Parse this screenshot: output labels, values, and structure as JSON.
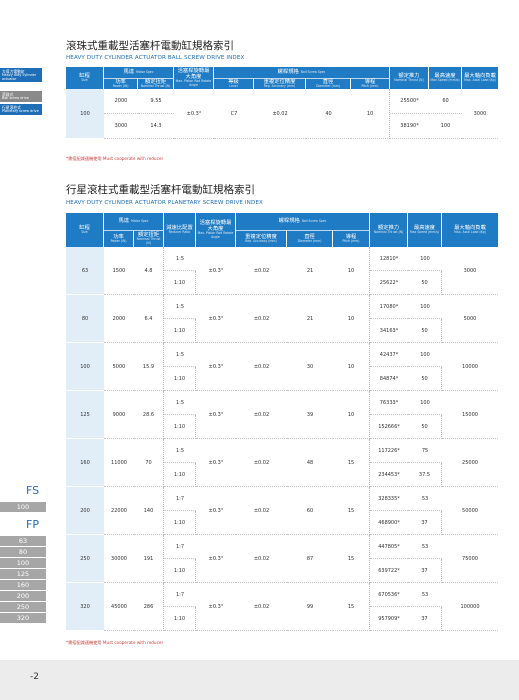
{
  "sidebar": {
    "items": [
      {
        "line1": "大導力電動缸",
        "line2": "Heavy duty cylinder",
        "line3": "actuator"
      },
      {
        "line1": "滾珠式",
        "line2": "Ball screw drive"
      },
      {
        "line1": "行星滾柱式",
        "line2": "Planetary screw drive"
      }
    ],
    "colors": {
      "item0": "#1f6fb8",
      "item1": "#888888",
      "item2": "#1f6fb8"
    }
  },
  "section1": {
    "title_zh": "滾珠式重載型活塞杆電動缸規格索引",
    "title_en": "HEAVY DUTY CYLINDER ACTUATOR BALL SCREW DRIVE INDEX",
    "headers": {
      "size_zh": "缸程",
      "size_en": "Size",
      "motor_zh": "馬達",
      "motor_en": "Motor Spec",
      "power_zh": "功率",
      "power_en": "Power (W)",
      "thrust_zh": "額定扭矩",
      "thrust_en": "Nominal Thrust (N)",
      "angle_zh": "活塞桿旋轉最大角度",
      "angle_en": "Max. Piston Rod Rotate Angle",
      "screw_zh": "螺桿規格",
      "screw_en": "Ball Screw Spec",
      "level_zh": "等級",
      "level_en": "Level",
      "acc_zh": "重複定位精度",
      "acc_en": "Rep. Accuracy (mm)",
      "dia_zh": "直徑",
      "dia_en": "Diameter (mm)",
      "pitch_zh": "導程",
      "pitch_en": "Pitch (mm)",
      "nt_zh": "額定推力",
      "nt_en": "Nominal Thrust (N)",
      "speed_zh": "最高速度",
      "speed_en": "Max Speed (mm/s)",
      "axial_zh": "最大軸向負載",
      "axial_en": "Max. Axial Load (Kg)"
    },
    "row": {
      "size": "100",
      "power1": "2000",
      "thrust1": "9.55",
      "power2": "3000",
      "thrust2": "14.3",
      "angle": "±0.3°",
      "level": "C7",
      "acc": "±0.02",
      "dia": "40",
      "pitch": "10",
      "nt1": "25500*",
      "speed1": "60",
      "nt2": "38190*",
      "speed2": "100",
      "axial": "3000"
    },
    "note": "*需搭配減速機使用 Must cooperate with reducer"
  },
  "section2": {
    "title_zh": "行星滾柱式重載型活塞杆電動缸規格索引",
    "title_en": "HEAVY DUTY CYLINDER ACTUATOR PLANETARY SCREW DRIVE INDEX",
    "headers": {
      "ratio_zh": "減速比配置",
      "ratio_en": "Reducer Ratio",
      "angle_zh": "活塞桿旋轉最大角度",
      "angle_en": "Max. Piston Rod Rotate Angle",
      "acc_zh": "重複定位精度",
      "acc_en": "Rep. Accuracy (mm)"
    },
    "rows": [
      {
        "size": "63",
        "power": "1500",
        "thrust": "4.8",
        "r1": "1:5",
        "r2": "1:10",
        "angle": "±0.3°",
        "acc": "±0.02",
        "dia": "21",
        "pitch": "10",
        "nt1": "12810*",
        "nt2": "25622*",
        "sp1": "100",
        "sp2": "50",
        "axial": "3000"
      },
      {
        "size": "80",
        "power": "2000",
        "thrust": "6.4",
        "r1": "1:5",
        "r2": "1:10",
        "angle": "±0.3°",
        "acc": "±0.02",
        "dia": "21",
        "pitch": "10",
        "nt1": "17080*",
        "nt2": "34163*",
        "sp1": "100",
        "sp2": "50",
        "axial": "5000"
      },
      {
        "size": "100",
        "power": "5000",
        "thrust": "15.9",
        "r1": "1:5",
        "r2": "1:10",
        "angle": "±0.3°",
        "acc": "±0.02",
        "dia": "30",
        "pitch": "10",
        "nt1": "42437*",
        "nt2": "84874*",
        "sp1": "100",
        "sp2": "50",
        "axial": "10000"
      },
      {
        "size": "125",
        "power": "9000",
        "thrust": "28.6",
        "r1": "1:5",
        "r2": "1:10",
        "angle": "±0.3°",
        "acc": "±0.02",
        "dia": "39",
        "pitch": "10",
        "nt1": "76333*",
        "nt2": "152666*",
        "sp1": "100",
        "sp2": "50",
        "axial": "15000"
      },
      {
        "size": "160",
        "power": "11000",
        "thrust": "70",
        "r1": "1:5",
        "r2": "1:10",
        "angle": "±0.3°",
        "acc": "±0.02",
        "dia": "48",
        "pitch": "15",
        "nt1": "117226*",
        "nt2": "234453*",
        "sp1": "75",
        "sp2": "37.5",
        "axial": "25000"
      },
      {
        "size": "200",
        "power": "22000",
        "thrust": "140",
        "r1": "1:7",
        "r2": "1:10",
        "angle": "±0.3°",
        "acc": "±0.02",
        "dia": "60",
        "pitch": "15",
        "nt1": "328335*",
        "nt2": "468900*",
        "sp1": "53",
        "sp2": "37",
        "axial": "50000"
      },
      {
        "size": "250",
        "power": "30000",
        "thrust": "191",
        "r1": "1:7",
        "r2": "1:10",
        "angle": "±0.3°",
        "acc": "±0.02",
        "dia": "87",
        "pitch": "15",
        "nt1": "447805*",
        "nt2": "639722*",
        "sp1": "53",
        "sp2": "37",
        "axial": "75000"
      },
      {
        "size": "320",
        "power": "45000",
        "thrust": "286",
        "r1": "1:7",
        "r2": "1:10",
        "angle": "±0.3°",
        "acc": "±0.02",
        "dia": "99",
        "pitch": "15",
        "nt1": "670536*",
        "nt2": "957909*",
        "sp1": "53",
        "sp2": "37",
        "axial": "100000"
      }
    ],
    "note": "*需搭配減速機使用 Must cooperate with reducer"
  },
  "side_index": {
    "fs_label": "FS",
    "fs_items": [
      "100"
    ],
    "fp_label": "FP",
    "fp_items": [
      "63",
      "80",
      "100",
      "125",
      "160",
      "200",
      "250",
      "320"
    ],
    "accent": "#1f6fb8"
  },
  "footer": {
    "page": "-2"
  }
}
